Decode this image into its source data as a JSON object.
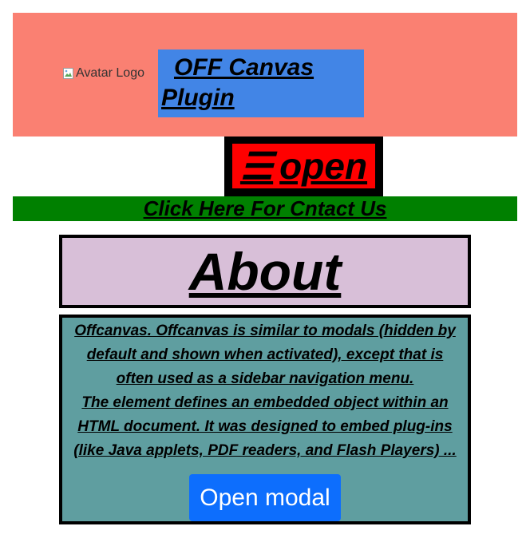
{
  "header": {
    "logo_alt": "Avatar Logo",
    "title": "OFF Canvas Plugin"
  },
  "open_button": {
    "icon": "☰",
    "label": "open"
  },
  "contact_link": "Click Here For Cntact Us",
  "about": {
    "heading": "About"
  },
  "content": {
    "lines": [
      "Offcanvas. Offcanvas is similar to modals (hidden by",
      "default and shown when activated), except that is",
      "often used as a sidebar navigation menu.",
      "The element defines an embedded object within an",
      "HTML document. It was designed to embed plug-ins",
      "(like Java applets, PDF readers, and Flash Players) ..."
    ],
    "modal_button": "Open modal"
  },
  "colors": {
    "header_bg": "#fa8072",
    "title_bg": "#4285e6",
    "open_bg": "#ff0000",
    "contact_bg": "#008000",
    "about_bg": "#d8bfd8",
    "content_bg": "#5f9ea0",
    "modal_btn_bg": "#0d6efd"
  },
  "icons": {
    "logo": "broken-image-icon",
    "open": "hamburger-icon"
  }
}
